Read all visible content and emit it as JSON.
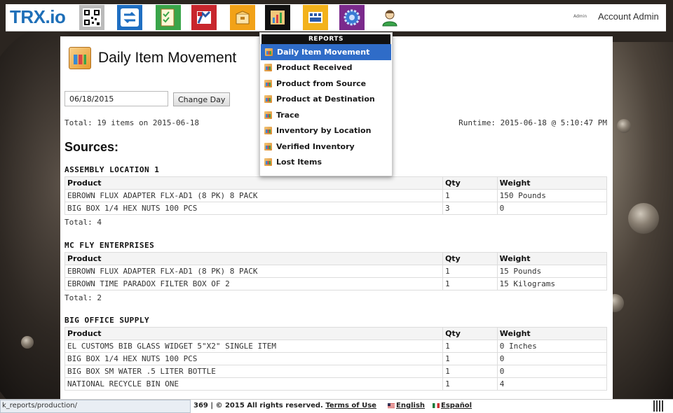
{
  "topbar": {
    "logo": "TRX.io",
    "admin_small": "Admin",
    "account": "Account Admin",
    "buttons": [
      {
        "name": "qr-code",
        "icon": "qr-code-icon",
        "color": "#bbbbbb"
      },
      {
        "name": "movement",
        "icon": "transfer-arrows-icon",
        "color": "#1f6fc2"
      },
      {
        "name": "checklist",
        "icon": "checklist-icon",
        "color": "#3aa54a"
      },
      {
        "name": "book",
        "icon": "book-icon",
        "color": "#c8262d"
      },
      {
        "name": "box",
        "icon": "box-icon",
        "color": "#f2a218"
      },
      {
        "name": "reports",
        "icon": "reports-chart-icon",
        "color": "#111111"
      },
      {
        "name": "facility",
        "icon": "factory-icon",
        "color": "#f3b21b"
      },
      {
        "name": "settings",
        "icon": "gear-icon",
        "color": "#7b2a8c"
      },
      {
        "name": "user",
        "icon": "user-icon",
        "color": "#ffffff"
      }
    ]
  },
  "page": {
    "title": "Daily Item Movement",
    "date_value": "06/18/2015",
    "change_day_label": "Change Day",
    "total_line": "Total: 19 items on 2015-06-18",
    "runtime": "Runtime: 2015-06-18 @ 5:10:47 PM",
    "sources_heading": "Sources:",
    "columns": [
      "Product",
      "Qty",
      "Weight"
    ],
    "groups": [
      {
        "name": "ASSEMBLY LOCATION 1",
        "rows": [
          [
            "EBROWN FLUX ADAPTER FLX-AD1 (8 PK) 8 PACK",
            "1",
            "150 Pounds"
          ],
          [
            "BIG BOX 1/4 HEX NUTS 100 PCS",
            "3",
            "0"
          ]
        ],
        "total": "Total: 4"
      },
      {
        "name": "MC FLY ENTERPRISES",
        "rows": [
          [
            "EBROWN FLUX ADAPTER FLX-AD1 (8 PK) 8 PACK",
            "1",
            "15 Pounds"
          ],
          [
            "EBROWN TIME PARADOX FILTER BOX OF 2",
            "1",
            "15 Kilograms"
          ]
        ],
        "total": "Total: 2"
      },
      {
        "name": "BIG OFFICE SUPPLY",
        "rows": [
          [
            "EL CUSTOMS BIB GLASS WIDGET 5\"X2\" SINGLE ITEM",
            "1",
            "0 Inches"
          ],
          [
            "BIG BOX 1/4 HEX NUTS 100 PCS",
            "1",
            "0"
          ],
          [
            "BIG BOX SM WATER .5 LITER BOTTLE",
            "1",
            "0"
          ],
          [
            "NATIONAL RECYCLE BIN ONE",
            "1",
            "4"
          ]
        ],
        "total": ""
      }
    ]
  },
  "reports_menu": {
    "heading": "REPORTS",
    "items": [
      {
        "label": "Daily Item Movement",
        "active": true
      },
      {
        "label": "Product Received",
        "active": false
      },
      {
        "label": "Product from Source",
        "active": false
      },
      {
        "label": "Product at Destination",
        "active": false
      },
      {
        "label": "Trace",
        "active": false
      },
      {
        "label": "Inventory by Location",
        "active": false
      },
      {
        "label": "Verified Inventory",
        "active": false
      },
      {
        "label": "Lost Items",
        "active": false
      }
    ]
  },
  "footer": {
    "status_url": "k_reports/production/",
    "copyright_prefix": "369 | © 2015 All rights reserved.",
    "terms": "Terms of Use",
    "lang_en": "English",
    "lang_es": "Español"
  }
}
